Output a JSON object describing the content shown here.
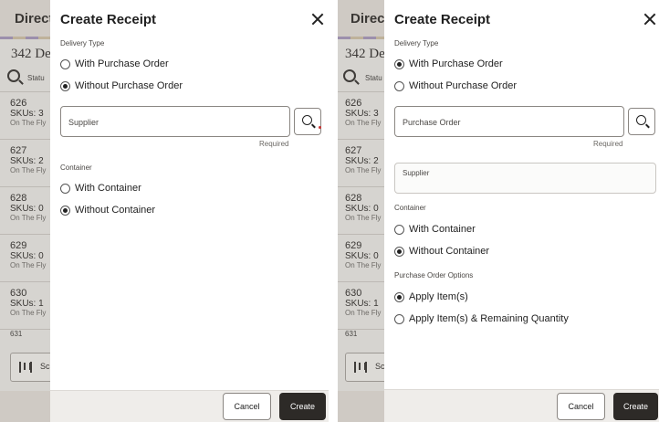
{
  "background": {
    "header_title": "Direct",
    "subtitle": "342 De",
    "filter_label": "Statu",
    "rows": [
      {
        "number": "626",
        "skus": "SKUs: 3",
        "note": "On The Fly"
      },
      {
        "number": "627",
        "skus": "SKUs: 2",
        "note": "On The Fly"
      },
      {
        "number": "628",
        "skus": "SKUs: 0",
        "note": "On The Fly"
      },
      {
        "number": "629",
        "skus": "SKUs: 0",
        "note": "On The Fly"
      },
      {
        "number": "630",
        "skus": "SKUs: 1",
        "note": "On The Fly"
      }
    ],
    "partial_row": "631",
    "scan_label": "Sc",
    "scan_icon": "barcode-scan-icon"
  },
  "left_drawer": {
    "title": "Create Receipt",
    "delivery_type_label": "Delivery Type",
    "delivery_options": [
      {
        "label": "With Purchase Order",
        "checked": false
      },
      {
        "label": "Without Purchase Order",
        "checked": true
      }
    ],
    "supplier_placeholder": "Supplier",
    "required_label": "Required",
    "container_label": "Container",
    "container_options": [
      {
        "label": "With Container",
        "checked": false
      },
      {
        "label": "Without Container",
        "checked": true
      }
    ],
    "cancel_label": "Cancel",
    "create_label": "Create"
  },
  "right_drawer": {
    "title": "Create Receipt",
    "delivery_type_label": "Delivery Type",
    "delivery_options": [
      {
        "label": "With Purchase Order",
        "checked": true
      },
      {
        "label": "Without Purchase Order",
        "checked": false
      }
    ],
    "purchase_order_placeholder": "Purchase Order",
    "required_label": "Required",
    "supplier_label": "Supplier",
    "container_label": "Container",
    "container_options": [
      {
        "label": "With Container",
        "checked": false
      },
      {
        "label": "Without Container",
        "checked": true
      }
    ],
    "po_options_label": "Purchase Order Options",
    "po_options": [
      {
        "label": "Apply Item(s)",
        "checked": true
      },
      {
        "label": "Apply Item(s) & Remaining Quantity",
        "checked": false
      }
    ],
    "cancel_label": "Cancel",
    "create_label": "Create"
  }
}
